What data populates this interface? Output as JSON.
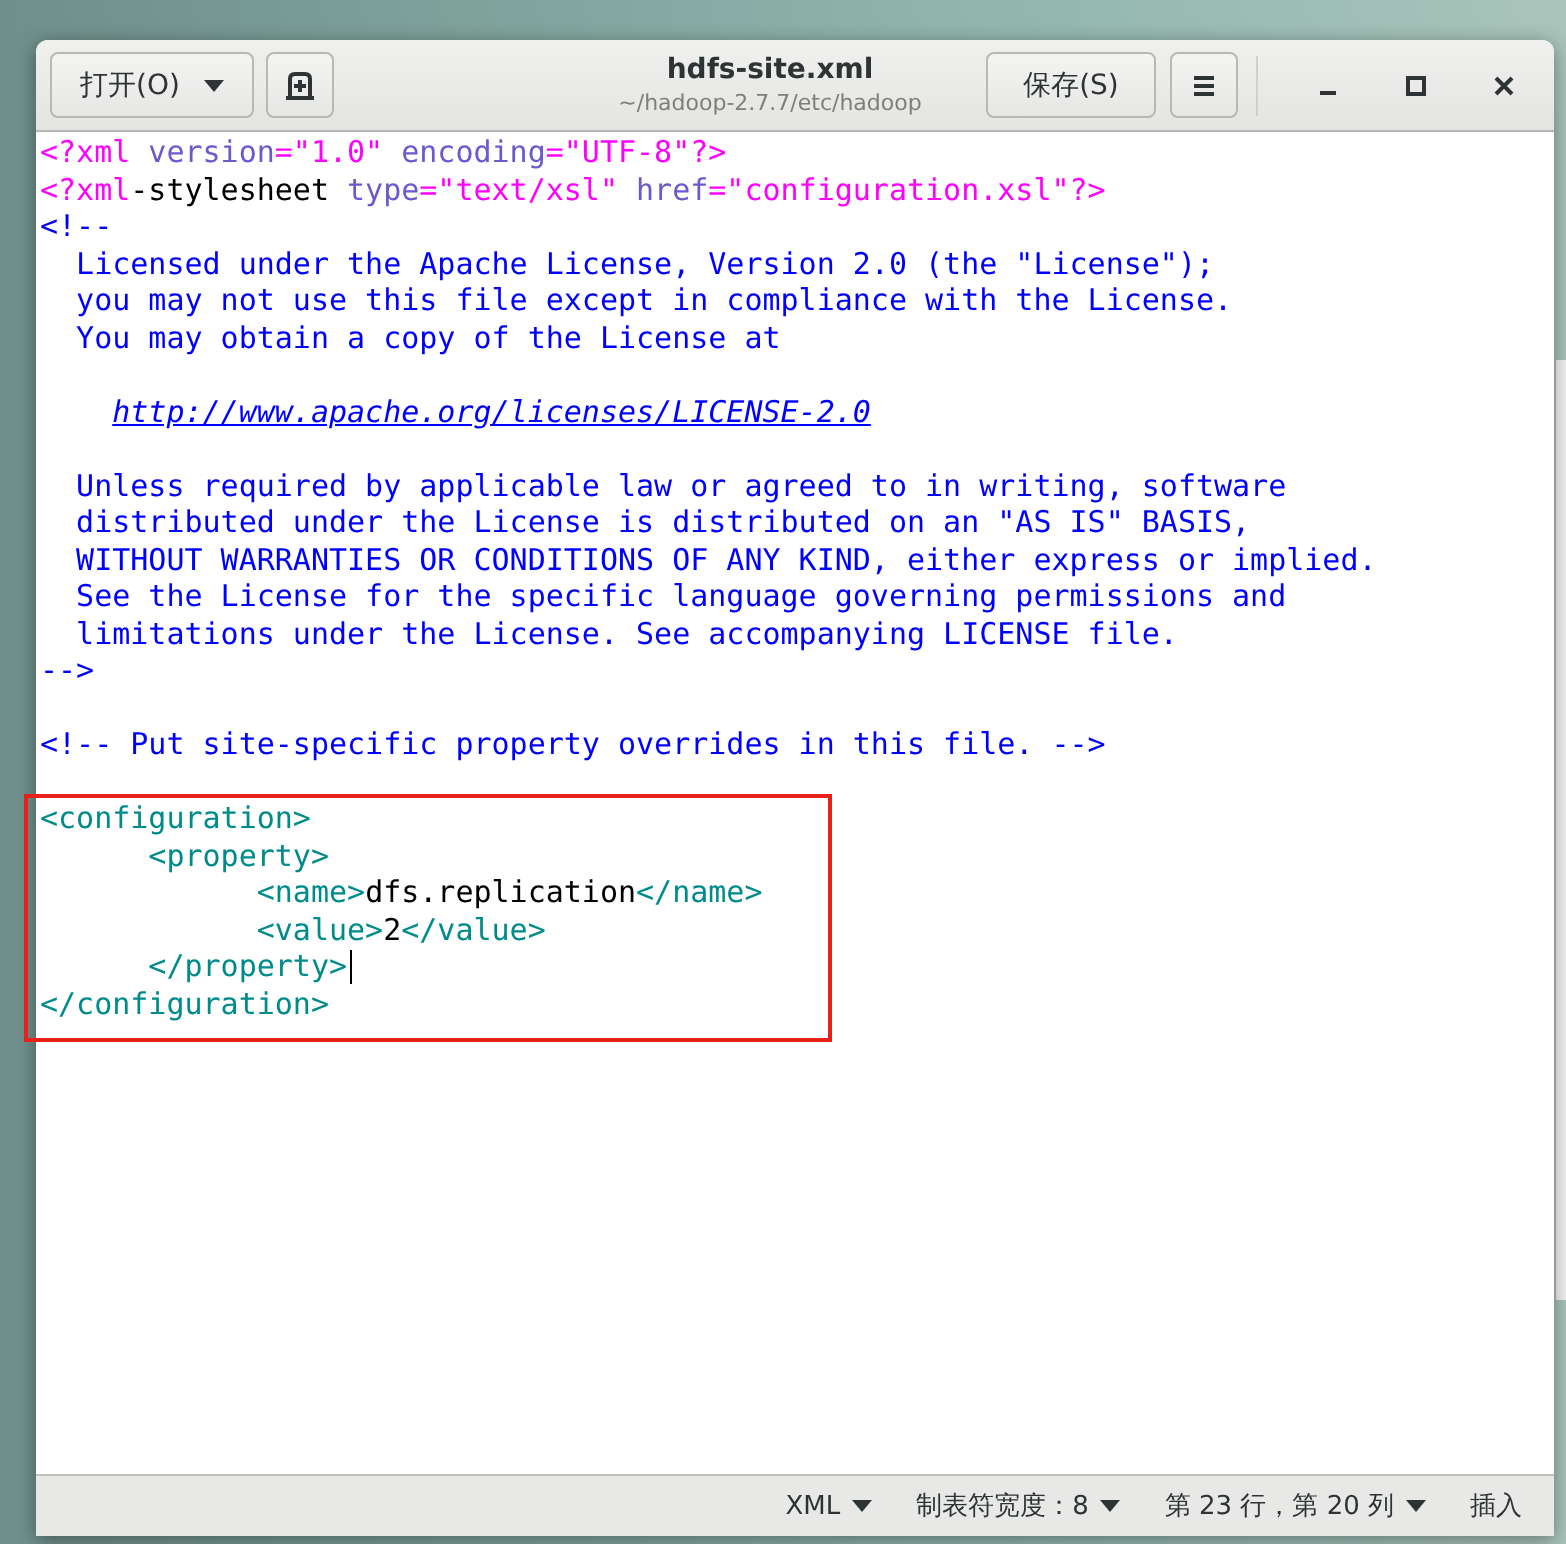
{
  "window": {
    "title": "hdfs-site.xml",
    "subtitle": "~/hadoop-2.7.7/etc/hadoop"
  },
  "header_buttons": [
    {
      "kind": "dropdown",
      "label": "打开(O)"
    },
    {
      "kind": "new-tab"
    }
  ],
  "save_button": {
    "label": "保存(S)"
  },
  "editor": {
    "lines": [
      {
        "segments": [
          {
            "kind": "pi",
            "text": "<?xml"
          },
          {
            "kind": "attr",
            "text": " version"
          },
          {
            "kind": "string",
            "text": "=\"1.0\""
          },
          {
            "kind": "attr",
            "text": " encoding"
          },
          {
            "kind": "string",
            "text": "=\"UTF-8\""
          },
          {
            "kind": "pi",
            "text": "?>"
          }
        ],
        "highlighted": false,
        "cursor": false
      },
      {
        "segments": [
          {
            "kind": "pi",
            "text": "<?xml"
          },
          {
            "kind": "text",
            "text": "-stylesheet "
          },
          {
            "kind": "attr",
            "text": "type"
          },
          {
            "kind": "string",
            "text": "=\"text/xsl\""
          },
          {
            "kind": "attr",
            "text": " href"
          },
          {
            "kind": "string",
            "text": "=\"configuration.xsl\""
          },
          {
            "kind": "pi",
            "text": "?>"
          }
        ],
        "highlighted": false,
        "cursor": false
      },
      {
        "segments": [
          {
            "kind": "comment",
            "text": "<!--"
          }
        ],
        "highlighted": false,
        "cursor": false
      },
      {
        "segments": [
          {
            "kind": "comment",
            "text": "  Licensed under the Apache License, Version 2.0 (the \"License\");"
          }
        ],
        "highlighted": false,
        "cursor": false
      },
      {
        "segments": [
          {
            "kind": "comment",
            "text": "  you may not use this file except in compliance with the License."
          }
        ],
        "highlighted": false,
        "cursor": false
      },
      {
        "segments": [
          {
            "kind": "comment",
            "text": "  You may obtain a copy of the License at"
          }
        ],
        "highlighted": false,
        "cursor": false
      },
      {
        "highlighted": false,
        "cursor": false
      },
      {
        "segments": [
          {
            "kind": "link",
            "text": "    http://www.apache.org/licenses/LICENSE-2.0"
          }
        ],
        "highlighted": false,
        "cursor": false
      },
      {
        "highlighted": false,
        "cursor": false
      },
      {
        "segments": [
          {
            "kind": "comment",
            "text": "  Unless required by applicable law or agreed to in writing, software"
          }
        ],
        "highlighted": false,
        "cursor": false
      },
      {
        "segments": [
          {
            "kind": "comment",
            "text": "  distributed under the License is distributed on an \"AS IS\" BASIS,"
          }
        ],
        "highlighted": false,
        "cursor": false
      },
      {
        "segments": [
          {
            "kind": "comment",
            "text": "  WITHOUT WARRANTIES OR CONDITIONS OF ANY KIND, either express or implied."
          }
        ],
        "highlighted": false,
        "cursor": false
      },
      {
        "segments": [
          {
            "kind": "comment",
            "text": "  See the License for the specific language governing permissions and"
          }
        ],
        "highlighted": false,
        "cursor": false
      },
      {
        "segments": [
          {
            "kind": "comment",
            "text": "  limitations under the License. See accompanying LICENSE file."
          }
        ],
        "highlighted": false,
        "cursor": false
      },
      {
        "segments": [
          {
            "kind": "comment",
            "text": "-->"
          }
        ],
        "highlighted": false,
        "cursor": false
      },
      {
        "highlighted": false,
        "cursor": false
      },
      {
        "segments": [
          {
            "kind": "comment",
            "text": "<!-- Put site-specific property overrides in this file. -->"
          }
        ],
        "highlighted": false,
        "cursor": false
      },
      {
        "highlighted": false,
        "cursor": false
      },
      {
        "segments": [
          {
            "kind": "tag",
            "text": "<configuration>"
          }
        ],
        "highlighted": true,
        "cursor": false
      },
      {
        "segments": [
          {
            "kind": "tag",
            "text": "      <property>"
          }
        ],
        "highlighted": true,
        "cursor": false
      },
      {
        "segments": [
          {
            "kind": "tag",
            "text": "            <name>"
          },
          {
            "kind": "text",
            "text": "dfs.replication"
          },
          {
            "kind": "tag",
            "text": "</name>"
          }
        ],
        "highlighted": true,
        "cursor": false
      },
      {
        "segments": [
          {
            "kind": "tag",
            "text": "            <value>"
          },
          {
            "kind": "text",
            "text": "2"
          },
          {
            "kind": "tag",
            "text": "</value>"
          }
        ],
        "highlighted": true,
        "cursor": false
      },
      {
        "segments": [
          {
            "kind": "tag",
            "text": "      </property>"
          }
        ],
        "highlighted": true,
        "cursor": true
      },
      {
        "segments": [
          {
            "kind": "tag",
            "text": "</configuration>"
          }
        ],
        "highlighted": true,
        "cursor": false
      }
    ]
  },
  "status_bar": [
    {
      "label": "XML",
      "dropdown": true
    },
    {
      "label": "制表符宽度：8",
      "dropdown": true
    },
    {
      "label": "第 23 行，第 20 列",
      "dropdown": true
    },
    {
      "label": "插入",
      "dropdown": false
    }
  ]
}
